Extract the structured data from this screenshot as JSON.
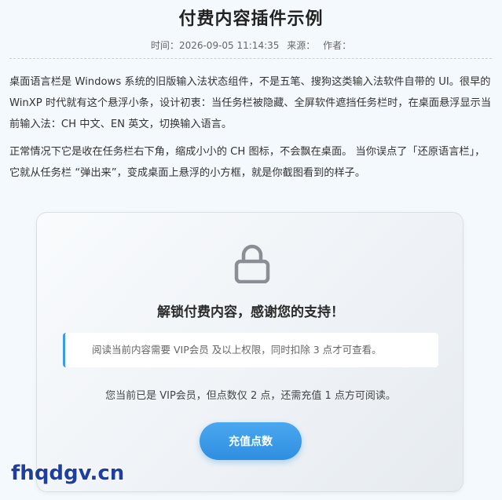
{
  "article": {
    "title": "付费内容插件示例",
    "meta": {
      "time_label": "时间：",
      "time_value": "2026-09-05 11:14:35",
      "source_label": "来源：",
      "author_label": "作者："
    },
    "paragraphs": [
      "桌面语言栏是 Windows 系统的旧版输入法状态组件，不是五笔、搜狗这类输入法软件自带的 UI。很早的 WinXP 时代就有这个悬浮小条，设计初衷：当任务栏被隐藏、全屏软件遮挡任务栏时，在桌面悬浮显示当前输入法：CH 中文、EN 英文，切换输入语言。",
      "正常情况下它是收在任务栏右下角，缩成小小的 CH 图标，不会飘在桌面。 当你误点了「还原语言栏」，它就从任务栏 “弹出来”，变成桌面上悬浮的小方框，就是你截图看到的样子。"
    ]
  },
  "paywall": {
    "icon": "lock-icon",
    "title": "解锁付费内容，感谢您的支持！",
    "notice": "阅读当前内容需要 VIP会员 及以上权限，同时扣除 3 点才可查看。",
    "status": "您当前已是 VIP会员，但点数仅 2 点，还需充值 1 点方可阅读。",
    "button_label": "充值点数",
    "accent_color": "#2f8ee0"
  },
  "watermark": "fhqdgv.cn"
}
